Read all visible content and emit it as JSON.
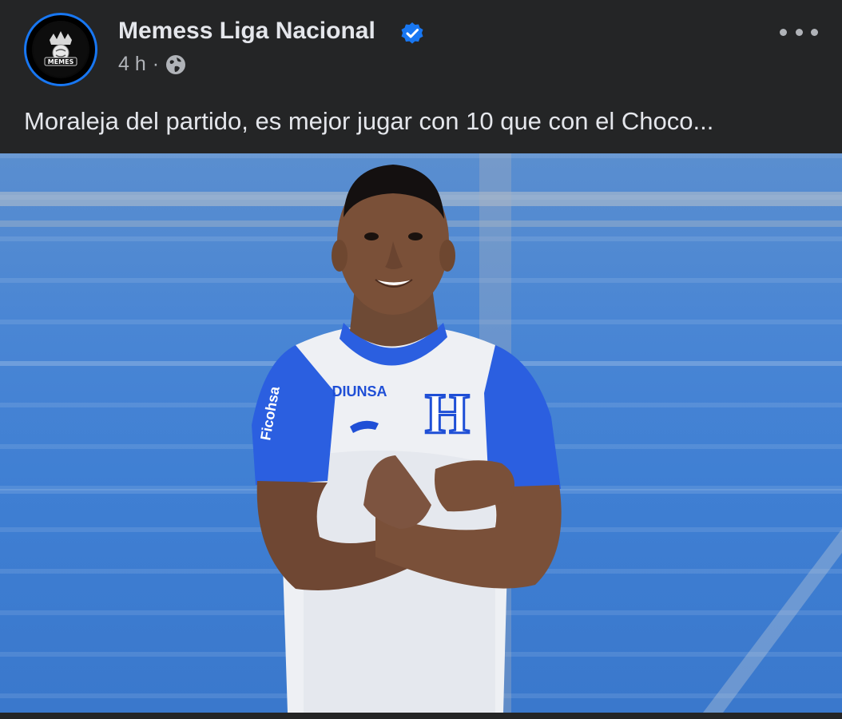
{
  "post": {
    "author": "Memess Liga Nacional",
    "verified": true,
    "timestamp": "4 h",
    "separator": "·",
    "audience_icon": "globe-icon",
    "text": "Moraleja del partido, es mejor jugar con 10 que con el Choco...",
    "more_icon": "more-horizontal-icon"
  },
  "avatar": {
    "logo_text": "MEMES",
    "logo_icon": "crown-icon"
  },
  "photo": {
    "jersey_sponsor": "DIUNSA",
    "jersey_crest": "H",
    "sleeve_text": "Ficohsa"
  },
  "colors": {
    "background": "#242526",
    "text_primary": "#e4e6eb",
    "text_secondary": "#b0b3b8",
    "accent_blue": "#1877f2",
    "stadium_blue": "#4a86d4",
    "jersey_blue": "#1f4fd6"
  }
}
